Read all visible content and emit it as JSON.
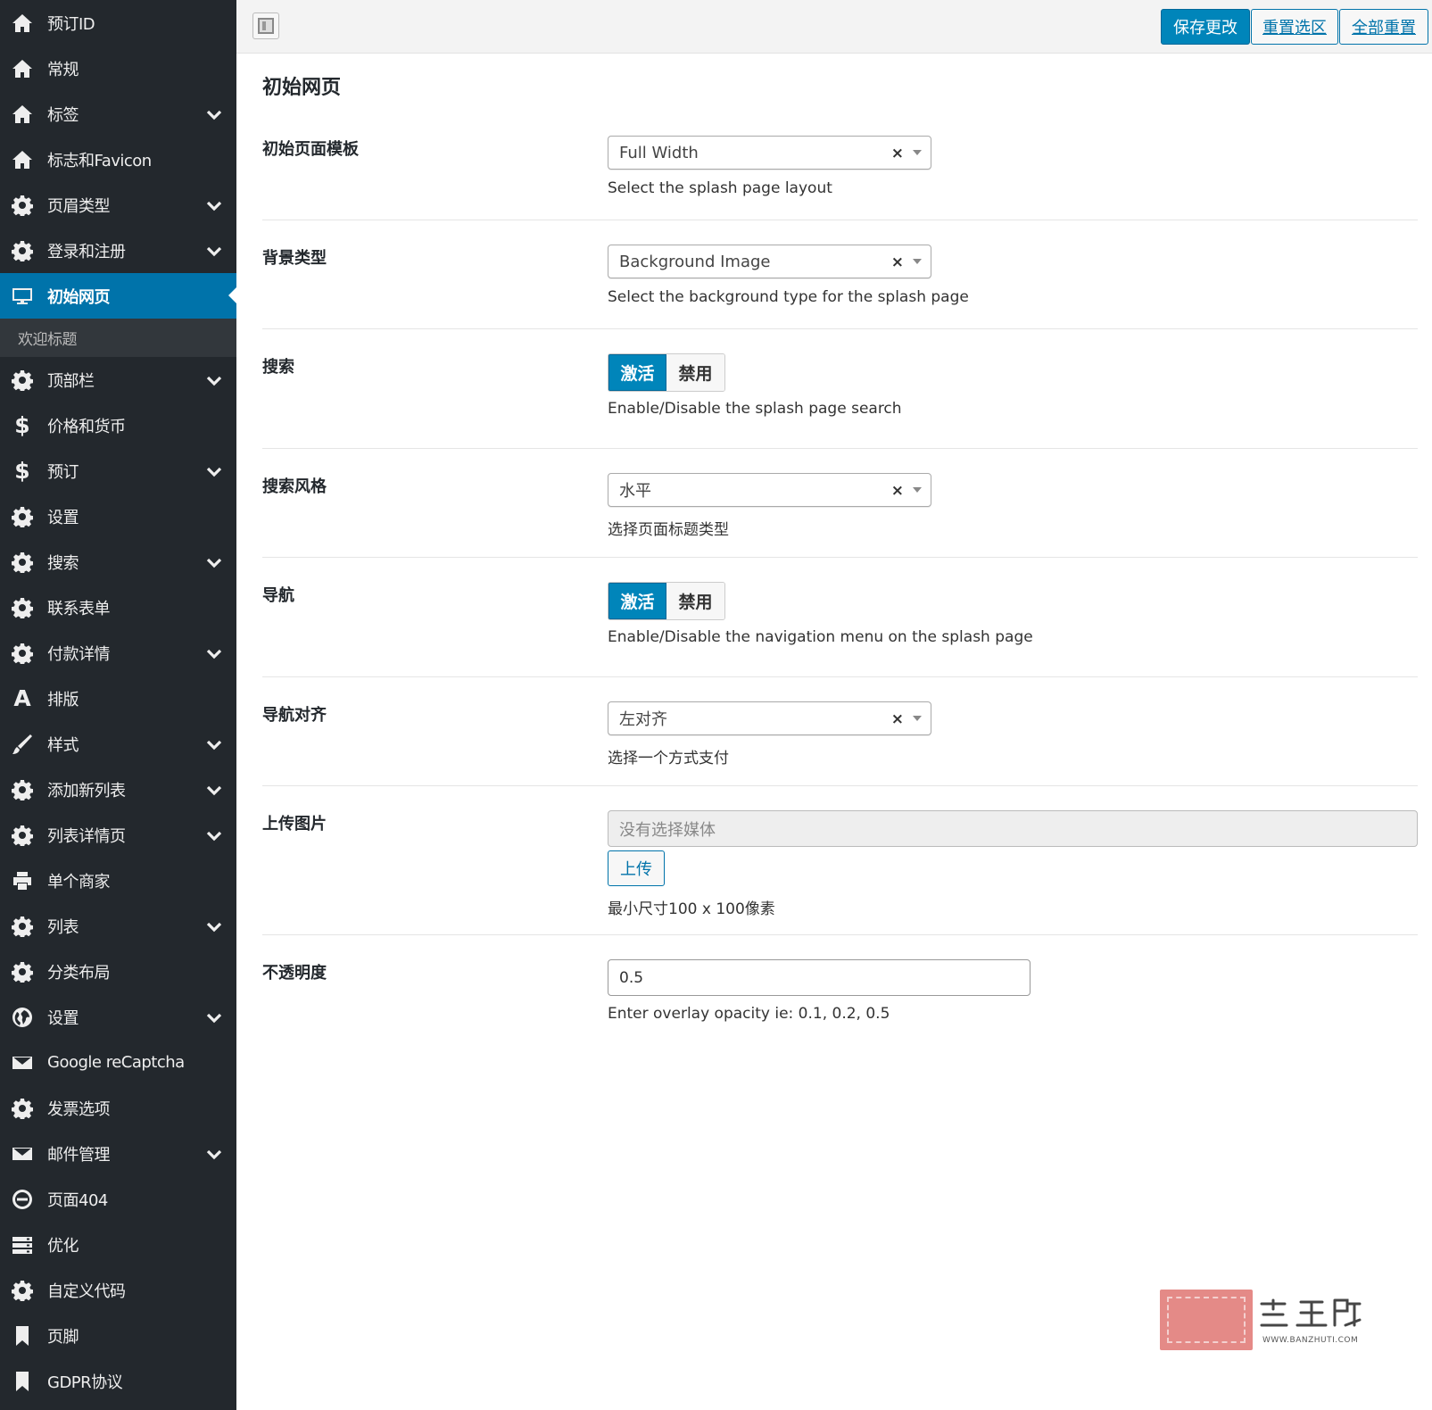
{
  "sidebar": {
    "items": [
      {
        "label": "预订ID",
        "icon": "home-icon",
        "chevron": false
      },
      {
        "label": "常规",
        "icon": "home-icon",
        "chevron": false
      },
      {
        "label": "标签",
        "icon": "home-icon",
        "chevron": true
      },
      {
        "label": "标志和Favicon",
        "icon": "home-icon",
        "chevron": false
      },
      {
        "label": "页眉类型",
        "icon": "gear-icon",
        "chevron": true
      },
      {
        "label": "登录和注册",
        "icon": "gear-icon",
        "chevron": true
      },
      {
        "label": "初始网页",
        "icon": "desktop-icon",
        "chevron": false,
        "active": true
      },
      {
        "label": "顶部栏",
        "icon": "gear-icon",
        "chevron": true
      },
      {
        "label": "价格和货币",
        "icon": "dollar-icon",
        "chevron": false
      },
      {
        "label": "预订",
        "icon": "dollar-icon",
        "chevron": true
      },
      {
        "label": "设置",
        "icon": "gear-icon",
        "chevron": false
      },
      {
        "label": "搜索",
        "icon": "gear-icon",
        "chevron": true
      },
      {
        "label": "联系表单",
        "icon": "gear-icon",
        "chevron": false
      },
      {
        "label": "付款详情",
        "icon": "gear-icon",
        "chevron": true
      },
      {
        "label": "排版",
        "icon": "font-icon",
        "chevron": false
      },
      {
        "label": "样式",
        "icon": "brush-icon",
        "chevron": true
      },
      {
        "label": "添加新列表",
        "icon": "gear-icon",
        "chevron": true
      },
      {
        "label": "列表详情页",
        "icon": "gear-icon",
        "chevron": true
      },
      {
        "label": "单个商家",
        "icon": "print-icon",
        "chevron": false
      },
      {
        "label": "列表",
        "icon": "gear-icon",
        "chevron": true
      },
      {
        "label": "分类布局",
        "icon": "gear-icon",
        "chevron": false
      },
      {
        "label": "设置",
        "icon": "globe-icon",
        "chevron": true
      },
      {
        "label": "Google reCaptcha",
        "icon": "envelope-icon",
        "chevron": false
      },
      {
        "label": "发票选项",
        "icon": "gear-icon",
        "chevron": false
      },
      {
        "label": "邮件管理",
        "icon": "envelope-icon",
        "chevron": true
      },
      {
        "label": "页面404",
        "icon": "minus-circle-icon",
        "chevron": false
      },
      {
        "label": "优化",
        "icon": "server-icon",
        "chevron": false
      },
      {
        "label": "自定义代码",
        "icon": "gear-icon",
        "chevron": false
      },
      {
        "label": "页脚",
        "icon": "bookmark-icon",
        "chevron": false
      },
      {
        "label": "GDPR协议",
        "icon": "bookmark-icon",
        "chevron": false
      }
    ],
    "subitem": {
      "label": "欢迎标题"
    }
  },
  "toolbar": {
    "save_label": "保存更改",
    "reset_section_label": "重置选区",
    "reset_all_label": "全部重置"
  },
  "main": {
    "title": "初始网页",
    "fields": {
      "template": {
        "label": "初始页面模板",
        "value": "Full Width",
        "desc": "Select the splash page layout"
      },
      "bg_type": {
        "label": "背景类型",
        "value": "Background Image",
        "desc": "Select the background type for the splash page"
      },
      "search": {
        "label": "搜索",
        "on": "激活",
        "off": "禁用",
        "desc": "Enable/Disable the splash page search"
      },
      "search_style": {
        "label": "搜索风格",
        "value": "水平",
        "desc": "选择页面标题类型"
      },
      "nav": {
        "label": "导航",
        "on": "激活",
        "off": "禁用",
        "desc": "Enable/Disable the navigation menu on the splash page"
      },
      "nav_align": {
        "label": "导航对齐",
        "value": "左对齐",
        "desc": "选择一个方式支付"
      },
      "upload": {
        "label": "上传图片",
        "placeholder": "没有选择媒体",
        "button": "上传",
        "desc": "最小尺寸100 x 100像素"
      },
      "opacity": {
        "label": "不透明度",
        "value": "0.5",
        "desc": "Enter overlay opacity ie: 0.1, 0.2, 0.5"
      }
    },
    "clear_glyph": "×"
  },
  "watermark": {
    "brand": "搬主题",
    "url": "WWW.BANZHUTI.COM"
  },
  "colors": {
    "sidebar_bg": "#23282d",
    "active_bg": "#0073aa",
    "primary": "#0085ba"
  }
}
